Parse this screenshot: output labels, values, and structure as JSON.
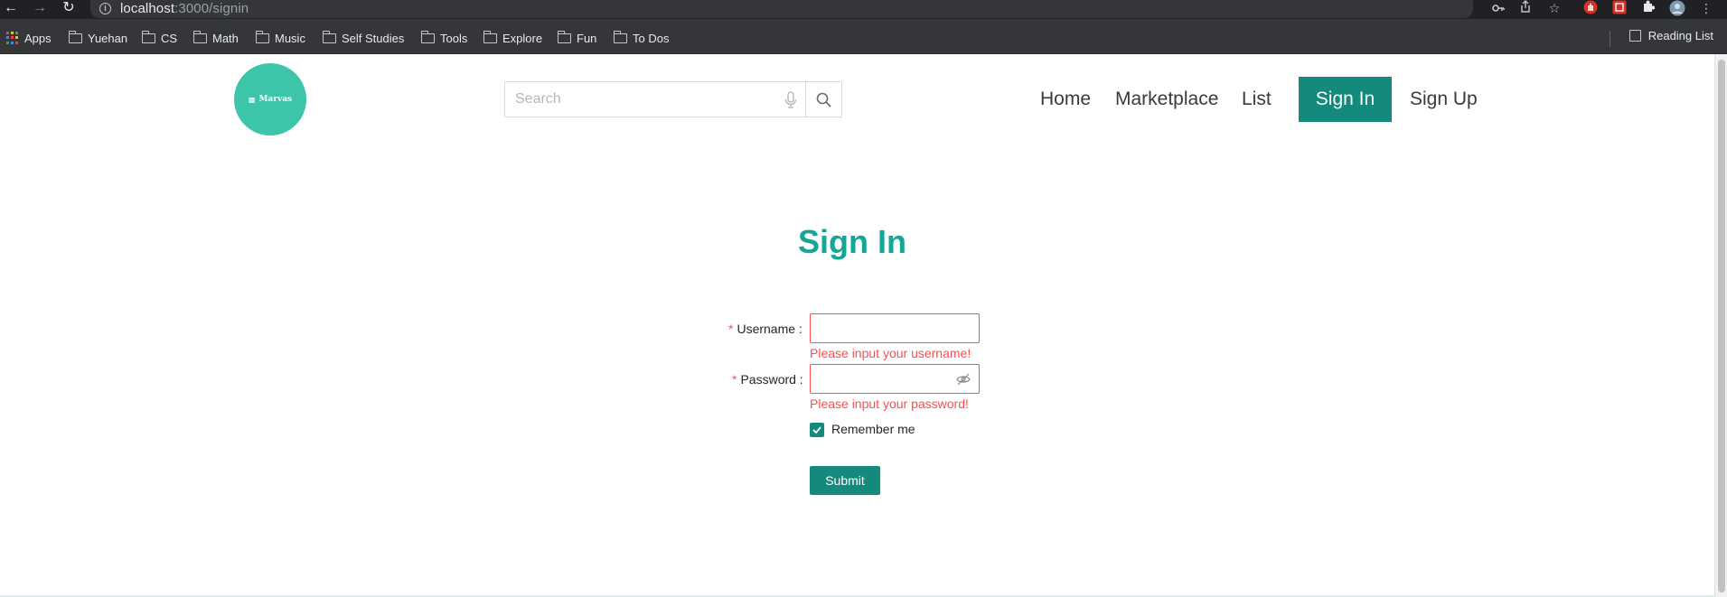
{
  "browser": {
    "url_host": "localhost",
    "url_rest": ":3000/signin",
    "icons": [
      "back-arrow-icon",
      "forward-arrow-icon",
      "reload-icon",
      "info-icon",
      "key-icon",
      "share-icon",
      "star-icon",
      "extension-red-icon",
      "extension-badge-icon",
      "puzzle-icon",
      "profile-avatar-icon",
      "kebab-menu-icon"
    ]
  },
  "bookmarks": {
    "items": [
      {
        "label": "Apps",
        "icon": "apps-grid-icon"
      },
      {
        "label": "Yuehan",
        "icon": "folder-icon"
      },
      {
        "label": "CS",
        "icon": "folder-icon"
      },
      {
        "label": "Math",
        "icon": "folder-icon"
      },
      {
        "label": "Music",
        "icon": "folder-icon"
      },
      {
        "label": "Self Studies",
        "icon": "folder-icon"
      },
      {
        "label": "Tools",
        "icon": "folder-icon"
      },
      {
        "label": "Explore",
        "icon": "folder-icon"
      },
      {
        "label": "Fun",
        "icon": "folder-icon"
      },
      {
        "label": "To Dos",
        "icon": "folder-icon"
      }
    ],
    "reading_list": "Reading List"
  },
  "header": {
    "logo_text": "Marvas",
    "search_placeholder": "Search",
    "nav": {
      "home": "Home",
      "marketplace": "Marketplace",
      "list": "List",
      "signin": "Sign In",
      "signup": "Sign Up"
    }
  },
  "form": {
    "title": "Sign In",
    "required_mark": "*",
    "username_label": "Username",
    "username_value": "",
    "username_error": "Please input your username!",
    "password_label": "Password",
    "password_value": "",
    "password_error": "Please input your password!",
    "remember_label": "Remember me",
    "remember_checked": true,
    "submit_label": "Submit"
  },
  "colors": {
    "accent": "#138a7c",
    "title": "#14a697",
    "logo_bg": "#3cc5a8",
    "error": "#ff4d4f",
    "chrome_dark": "#202124",
    "bookmarks_bg": "#35363a"
  }
}
